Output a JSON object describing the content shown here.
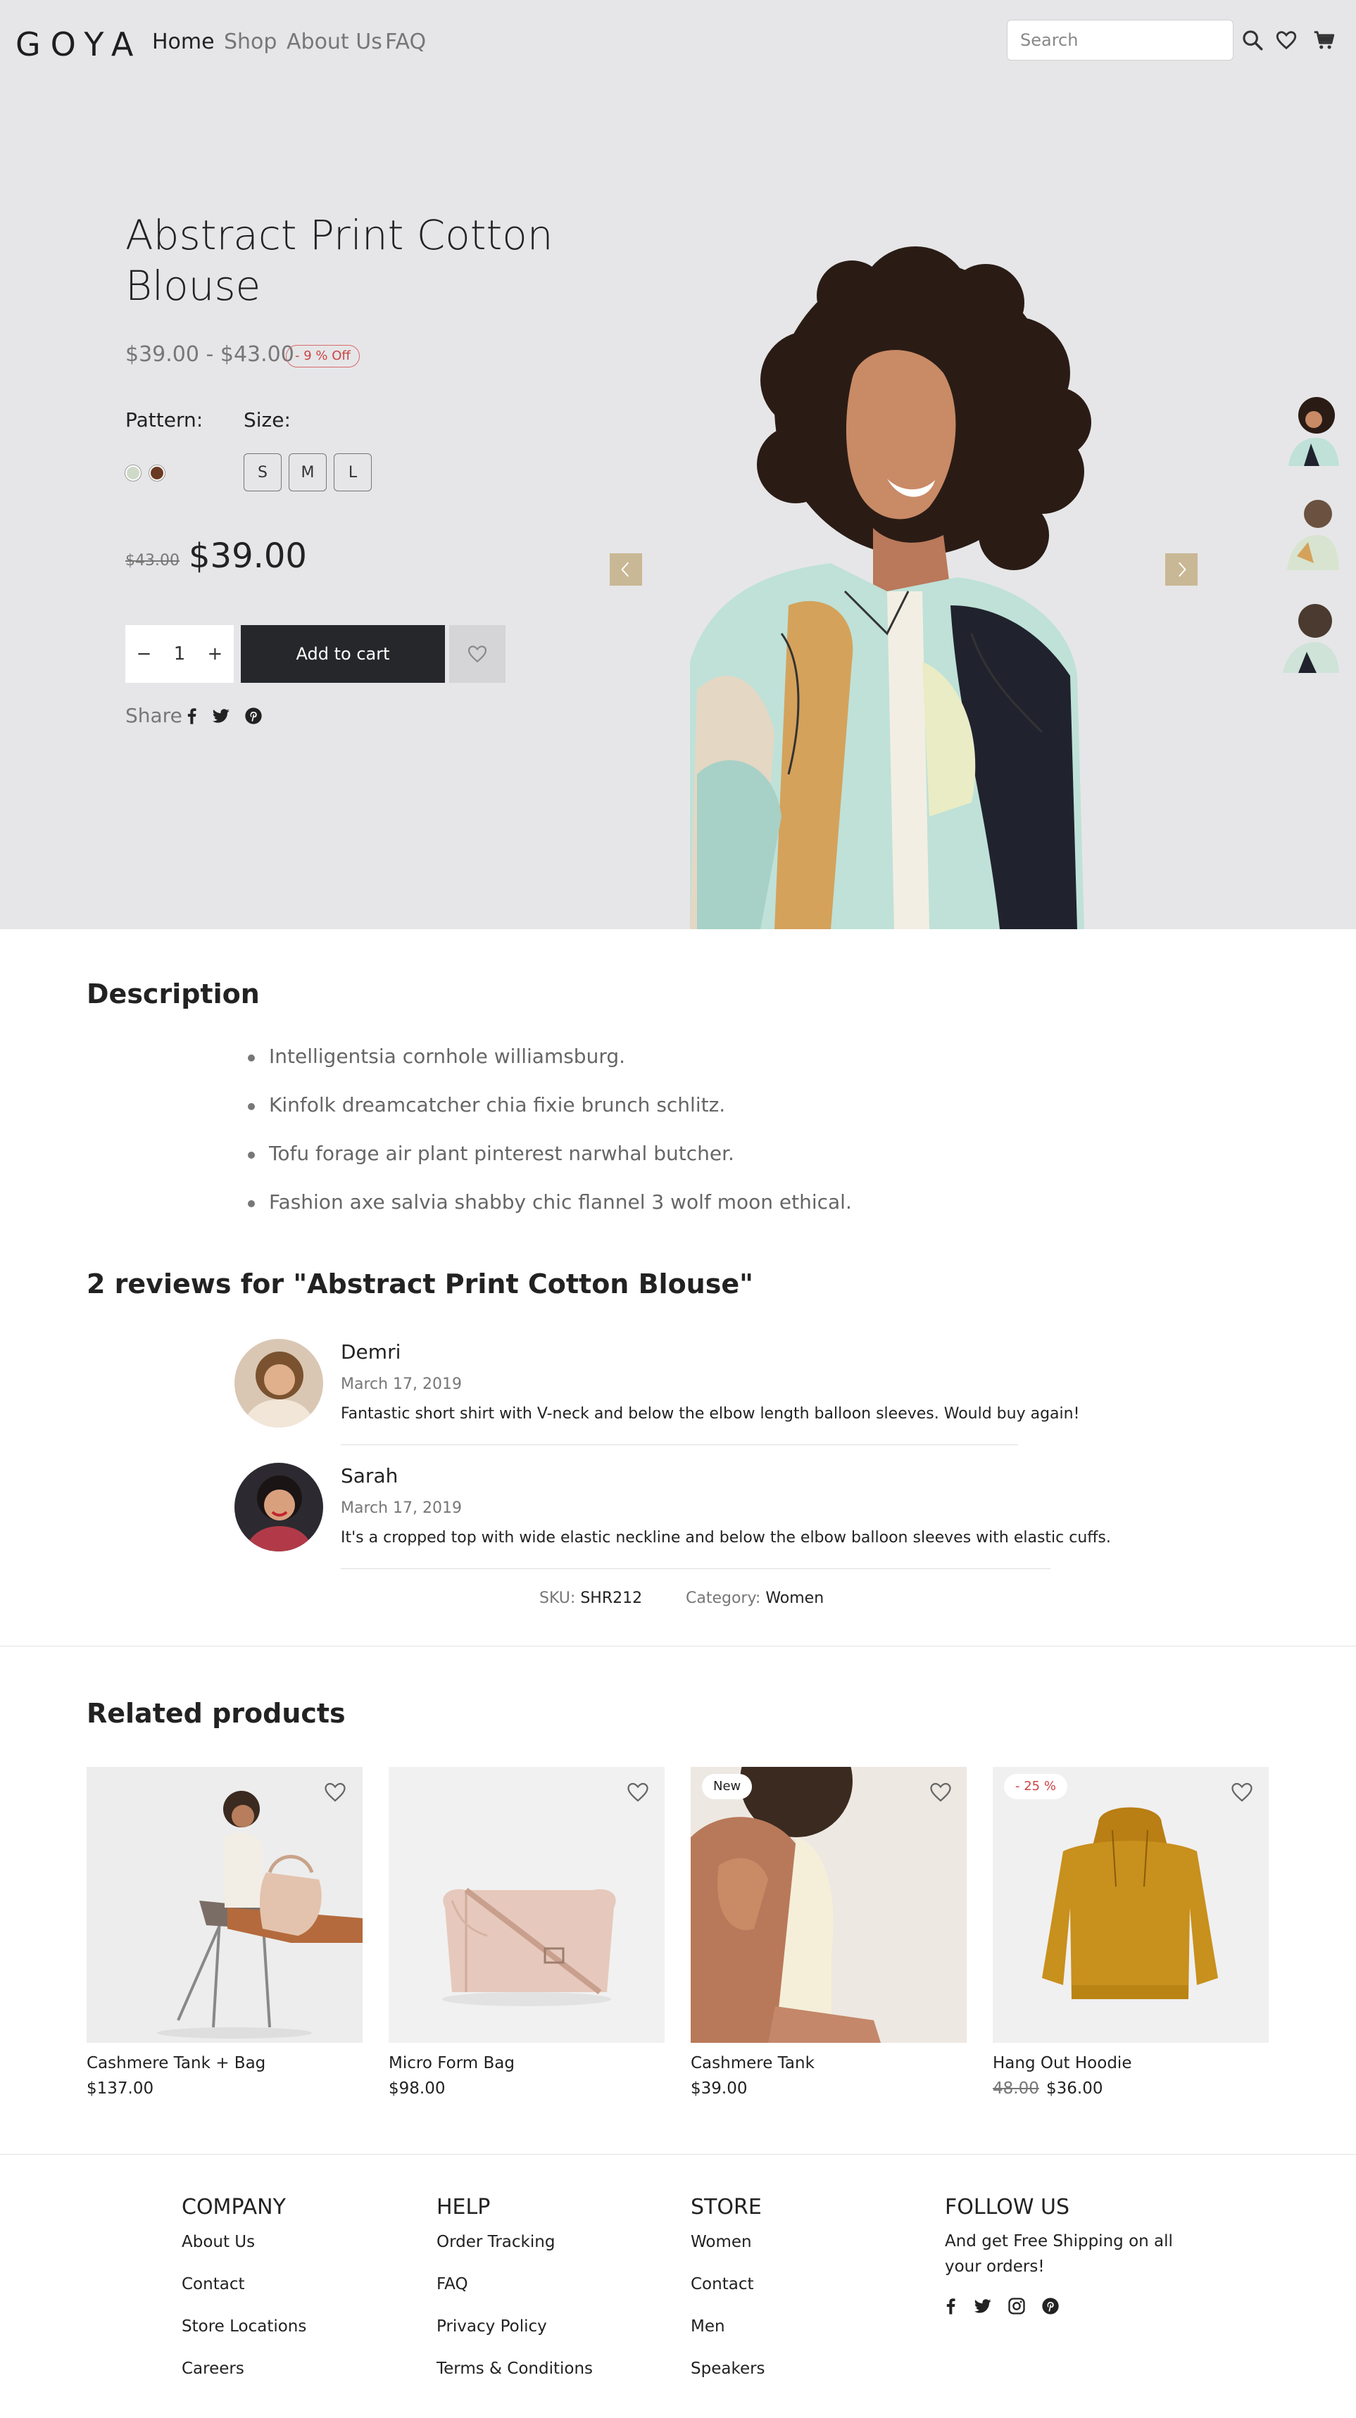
{
  "header": {
    "logo": "GOYA",
    "nav": [
      "Home",
      "Shop",
      "About Us",
      "FAQ"
    ],
    "search_placeholder": "Search"
  },
  "product": {
    "title": "Abstract Print Cotton Blouse",
    "price_range": "$39.00 - $43.00",
    "discount_badge": "- 9 % Off",
    "pattern_label": "Pattern:",
    "size_label": "Size:",
    "pattern_colors": [
      "#cfd9c7",
      "#6b3a22"
    ],
    "sizes": [
      "S",
      "M",
      "L"
    ],
    "old_price": "$43.00",
    "price": "$39.00",
    "quantity": "1",
    "qty_minus": "−",
    "qty_plus": "+",
    "add_to_cart": "Add to cart",
    "share_label": "Share"
  },
  "description": {
    "title": "Description",
    "items": [
      "Intelligentsia cornhole williamsburg.",
      "Kinfolk dreamcatcher chia fixie brunch schlitz.",
      "Tofu forage air plant pinterest narwhal butcher.",
      "Fashion axe salvia shabby chic flannel 3 wolf moon ethical."
    ]
  },
  "reviews": {
    "title": "2 reviews for \"Abstract Print Cotton Blouse\"",
    "items": [
      {
        "name": "Demri",
        "date": "March 17, 2019",
        "text": "Fantastic short shirt with V-neck and below the elbow length balloon sleeves. Would buy again!"
      },
      {
        "name": "Sarah",
        "date": "March 17, 2019",
        "text": "It's a cropped top with wide elastic neckline and below the elbow balloon sleeves with elastic cuffs."
      }
    ]
  },
  "meta": {
    "sku_label": "SKU:",
    "sku": "SHR212",
    "category_label": "Category:",
    "category": "Women"
  },
  "related": {
    "title": "Related products",
    "items": [
      {
        "name": "Cashmere Tank + Bag",
        "price": "$137.00",
        "badge": "",
        "old_price": ""
      },
      {
        "name": "Micro Form Bag",
        "price": "$98.00",
        "badge": "",
        "old_price": ""
      },
      {
        "name": "Cashmere Tank",
        "price": "$39.00",
        "badge": "New",
        "old_price": ""
      },
      {
        "name": "Hang Out Hoodie",
        "price": "$36.00",
        "badge": "- 25 %",
        "old_price": "48.00"
      }
    ]
  },
  "footer": {
    "company": {
      "title": "COMPANY",
      "links": [
        "About Us",
        "Contact",
        "Store Locations",
        "Careers"
      ]
    },
    "help": {
      "title": "HELP",
      "links": [
        "Order Tracking",
        "FAQ",
        "Privacy Policy",
        "Terms & Conditions"
      ]
    },
    "store": {
      "title": "STORE",
      "links": [
        "Women",
        "Contact",
        "Men",
        "Speakers"
      ]
    },
    "follow": {
      "title": "FOLLOW US",
      "text": "And get Free Shipping on all your orders!"
    }
  },
  "colors": {
    "hero_bg": "#e6e6e8",
    "button_dark": "#26272b",
    "sale_red": "#c44",
    "arrow_tan": "#c9b895"
  }
}
